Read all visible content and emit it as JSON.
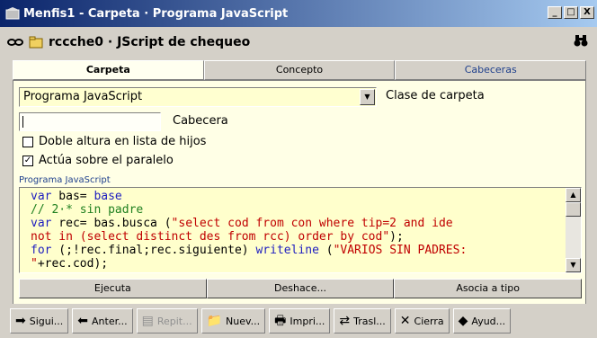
{
  "window": {
    "title": "Menfis1 - Carpeta · Programa JavaScript",
    "min": "_",
    "max": "□",
    "close": "X"
  },
  "header": {
    "title": "rccche0 · JScript de chequeo"
  },
  "tabs": [
    "Carpeta",
    "Concepto",
    "Cabeceras"
  ],
  "form": {
    "clase_value": "Programa JavaScript",
    "clase_label": "Clase de carpeta",
    "cabecera_value": "",
    "cabecera_label": "Cabecera",
    "doble_altura_label": "Doble altura en lista de hijos",
    "doble_altura_checked": false,
    "actua_label": "Actúa sobre el paralelo",
    "actua_checked": true,
    "code_section_label": "Programa JavaScript"
  },
  "code_lines": [
    [
      {
        "t": "var",
        "c": "kw"
      },
      {
        "t": " bas= "
      },
      {
        "t": "base",
        "c": "kw"
      }
    ],
    [
      {
        "t": "// 2·* sin padre",
        "c": "cm"
      }
    ],
    [
      {
        "t": "var",
        "c": "kw"
      },
      {
        "t": " rec= bas.busca ("
      },
      {
        "t": "\"select cod from con where tip=2 and ide",
        "c": "st"
      }
    ],
    [
      {
        "t": "not in (select distinct des from rcc) order by cod\"",
        "c": "st"
      },
      {
        "t": ");"
      }
    ],
    [
      {
        "t": "for",
        "c": "kw"
      },
      {
        "t": " (;!rec.final;rec.siguiente) "
      },
      {
        "t": "writeline",
        "c": "kw"
      },
      {
        "t": " ("
      },
      {
        "t": "\"VARIOS SIN PADRES:",
        "c": "st"
      }
    ],
    [
      {
        "t": "\"",
        "c": "st"
      },
      {
        "t": "+rec.cod);"
      }
    ]
  ],
  "actions": [
    "Ejecuta",
    "Deshace...",
    "Asocia a tipo"
  ],
  "toolbar": [
    {
      "label": "Sigui...",
      "icon": "arrow-right-icon",
      "glyph": "➡",
      "enabled": true
    },
    {
      "label": "Anter...",
      "icon": "arrow-left-icon",
      "glyph": "⬅",
      "enabled": true
    },
    {
      "label": "Repit...",
      "icon": "repeat-icon",
      "glyph": "▤",
      "enabled": false
    },
    {
      "label": "Nuev...",
      "icon": "new-folder-icon",
      "glyph": "📁",
      "enabled": true
    },
    {
      "label": "Impri...",
      "icon": "printer-icon",
      "glyph": "🖶",
      "enabled": true
    },
    {
      "label": "Trasl...",
      "icon": "transfer-icon",
      "glyph": "⇄",
      "enabled": true
    },
    {
      "label": "Cierra",
      "icon": "close-x-icon",
      "glyph": "✕",
      "enabled": true
    },
    {
      "label": "Ayud...",
      "icon": "help-book-icon",
      "glyph": "◆",
      "enabled": true
    }
  ],
  "colors": {
    "title_start": "#0a246a",
    "title_end": "#a6caf0",
    "panel_bg": "#ffffe6",
    "code_bg": "#ffffcc",
    "keyword": "#2020c0",
    "string": "#c00000",
    "comment": "#208020"
  }
}
